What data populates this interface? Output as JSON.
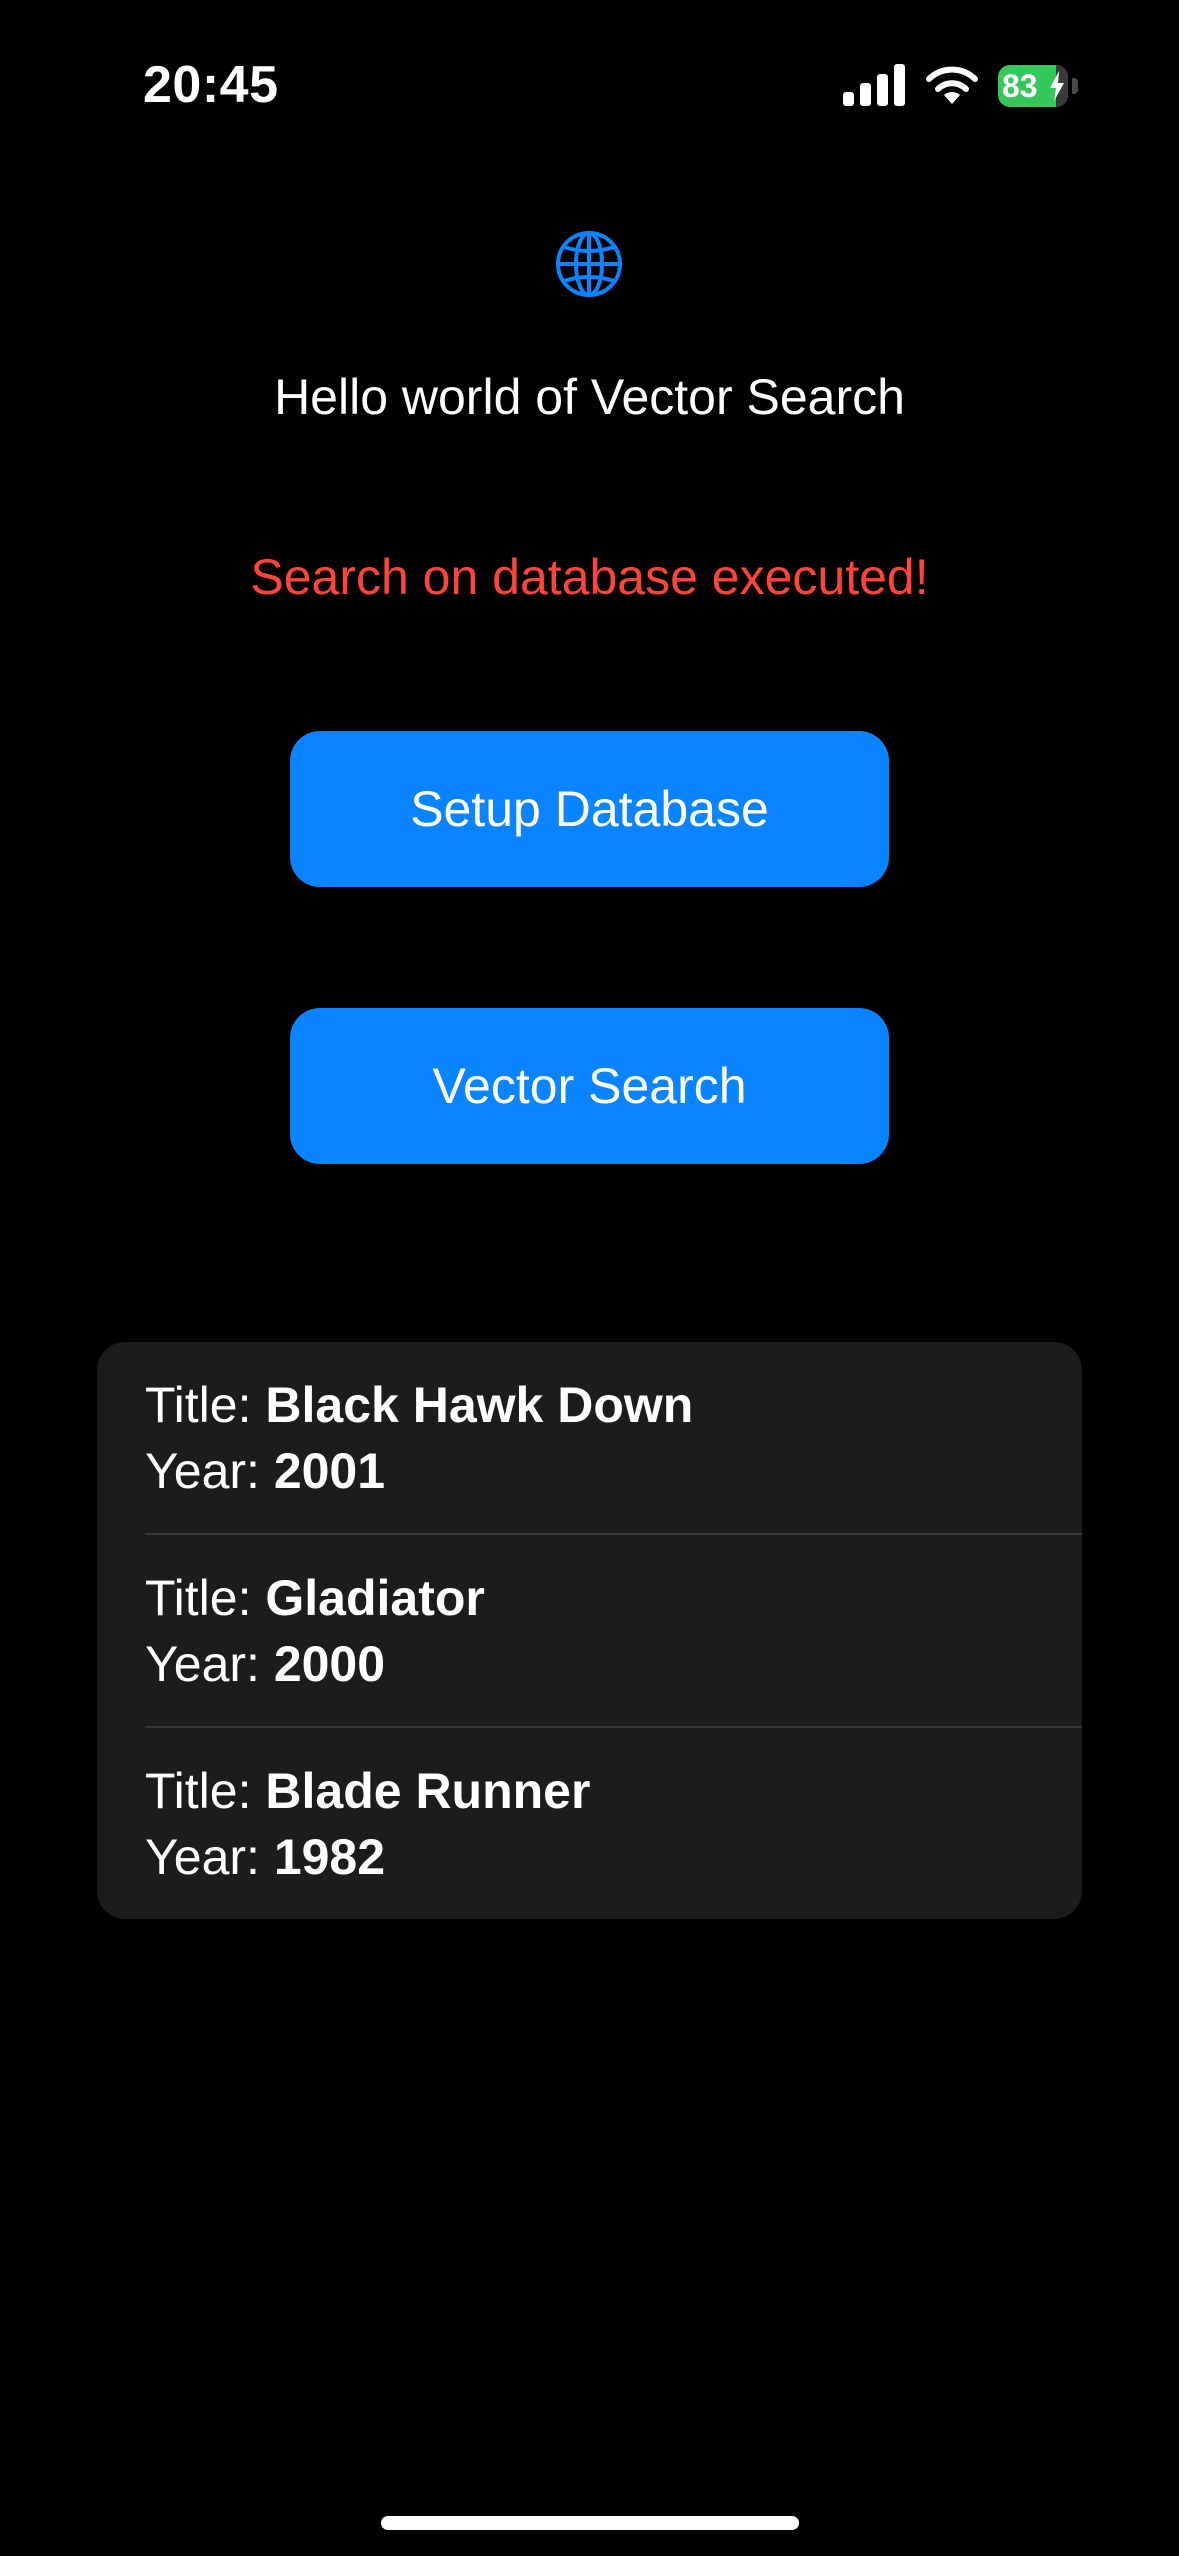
{
  "status_bar": {
    "time": "20:45",
    "battery_level": "83",
    "battery_fraction": 0.83,
    "signal_icon": "cellular-signal-icon",
    "wifi_icon": "wifi-icon",
    "charging_icon": "charging-bolt-icon"
  },
  "header": {
    "icon": "globe-icon",
    "greeting": "Hello world of Vector Search"
  },
  "status_message": "Search on database executed!",
  "buttons": {
    "setup_label": "Setup Database",
    "search_label": "Vector Search"
  },
  "results": [
    {
      "title_label": "Title: ",
      "title": "Black Hawk Down",
      "year_label": "Year: ",
      "year": "2001"
    },
    {
      "title_label": "Title: ",
      "title": "Gladiator",
      "year_label": "Year: ",
      "year": "2000"
    },
    {
      "title_label": "Title: ",
      "title": "Blade Runner",
      "year_label": "Year: ",
      "year": "1982"
    }
  ],
  "colors": {
    "background": "#000000",
    "accent": "#0a84ff",
    "status_message": "#ff453a",
    "list_background": "#1c1c1e",
    "battery": "#34c759"
  }
}
